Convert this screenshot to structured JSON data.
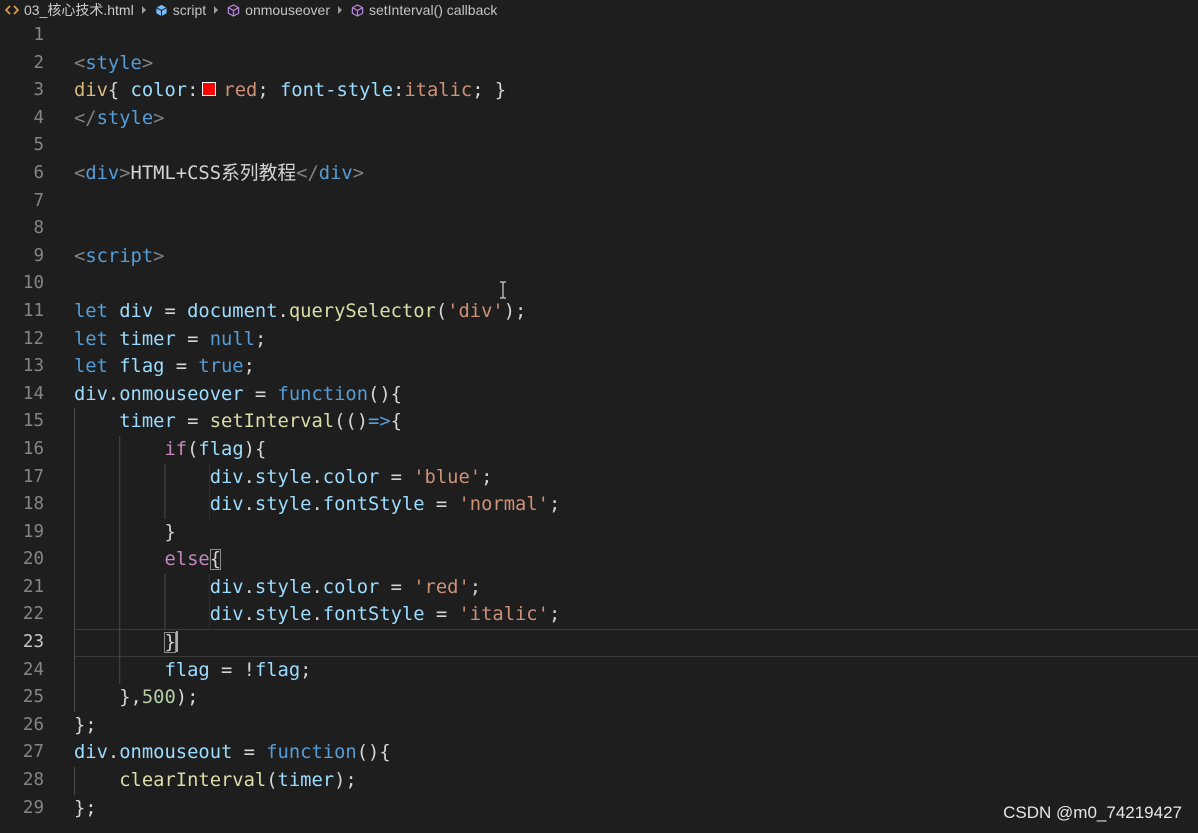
{
  "breadcrumb": {
    "separator_icon": "chevron-right-icon",
    "items": [
      {
        "label": "03_核心技术.html",
        "icon": "file-html-icon",
        "icon_color": "#e8a24f"
      },
      {
        "label": "script",
        "icon": "symbol-module-icon",
        "icon_color": "#75beff"
      },
      {
        "label": "onmouseover",
        "icon": "symbol-method-icon",
        "icon_color": "#b180d7"
      },
      {
        "label": "setInterval() callback",
        "icon": "symbol-method-icon",
        "icon_color": "#b180d7"
      }
    ]
  },
  "theme": {
    "background": "#1e1e1e",
    "line_number": "#858585",
    "line_number_active": "#c6c6c6",
    "indent_guide": "#4a4a4a",
    "tag-bracket": "#808080",
    "tag-name": "#569cd6",
    "css-selector": "#d7ba7d",
    "css-property": "#9cdcfe",
    "css-value": "#ce9178",
    "punctuation": "#d4d4d4",
    "keyword": "#569cd6",
    "variable": "#9cdcfe",
    "function": "#dcdcaa",
    "string": "#ce9178",
    "number": "#b5cea8",
    "control": "#c586c0",
    "text": "#d4d4d4",
    "whitespace": "#d4d4d4"
  },
  "editor": {
    "active_line": 23,
    "lines": [
      {
        "number": "1",
        "tokens": []
      },
      {
        "number": "2",
        "tokens": [
          {
            "type": "tag-bracket",
            "text": "<"
          },
          {
            "type": "tag-name",
            "text": "style"
          },
          {
            "type": "tag-bracket",
            "text": ">"
          }
        ]
      },
      {
        "number": "3",
        "tokens": [
          {
            "type": "css-selector",
            "text": "div"
          },
          {
            "type": "punctuation",
            "text": "{ "
          },
          {
            "type": "css-property",
            "text": "color"
          },
          {
            "type": "punctuation",
            "text": ":"
          },
          {
            "type": "swatch",
            "color": "#ff0000"
          },
          {
            "type": "css-value",
            "text": "red"
          },
          {
            "type": "punctuation",
            "text": "; "
          },
          {
            "type": "css-property",
            "text": "font-style"
          },
          {
            "type": "punctuation",
            "text": ":"
          },
          {
            "type": "css-value",
            "text": "italic"
          },
          {
            "type": "punctuation",
            "text": "; }"
          }
        ]
      },
      {
        "number": "4",
        "tokens": [
          {
            "type": "tag-bracket",
            "text": "</"
          },
          {
            "type": "tag-name",
            "text": "style"
          },
          {
            "type": "tag-bracket",
            "text": ">"
          }
        ]
      },
      {
        "number": "5",
        "tokens": []
      },
      {
        "number": "6",
        "tokens": [
          {
            "type": "tag-bracket",
            "text": "<"
          },
          {
            "type": "tag-name",
            "text": "div"
          },
          {
            "type": "tag-bracket",
            "text": ">"
          },
          {
            "type": "text",
            "text": "HTML+CSS系列教程"
          },
          {
            "type": "tag-bracket",
            "text": "</"
          },
          {
            "type": "tag-name",
            "text": "div"
          },
          {
            "type": "tag-bracket",
            "text": ">"
          }
        ]
      },
      {
        "number": "7",
        "tokens": []
      },
      {
        "number": "8",
        "tokens": []
      },
      {
        "number": "9",
        "tokens": [
          {
            "type": "tag-bracket",
            "text": "<"
          },
          {
            "type": "tag-name",
            "text": "script"
          },
          {
            "type": "tag-bracket",
            "text": ">"
          }
        ]
      },
      {
        "number": "10",
        "tokens": []
      },
      {
        "number": "11",
        "tokens": [
          {
            "type": "keyword",
            "text": "let"
          },
          {
            "type": "punctuation",
            "text": " "
          },
          {
            "type": "variable",
            "text": "div"
          },
          {
            "type": "punctuation",
            "text": " = "
          },
          {
            "type": "variable",
            "text": "document"
          },
          {
            "type": "punctuation",
            "text": "."
          },
          {
            "type": "function",
            "text": "querySelector"
          },
          {
            "type": "punctuation",
            "text": "("
          },
          {
            "type": "string",
            "text": "'div'"
          },
          {
            "type": "punctuation",
            "text": ");"
          }
        ]
      },
      {
        "number": "12",
        "tokens": [
          {
            "type": "keyword",
            "text": "let"
          },
          {
            "type": "punctuation",
            "text": " "
          },
          {
            "type": "variable",
            "text": "timer"
          },
          {
            "type": "punctuation",
            "text": " = "
          },
          {
            "type": "keyword",
            "text": "null"
          },
          {
            "type": "punctuation",
            "text": ";"
          }
        ]
      },
      {
        "number": "13",
        "tokens": [
          {
            "type": "keyword",
            "text": "let"
          },
          {
            "type": "punctuation",
            "text": " "
          },
          {
            "type": "variable",
            "text": "flag"
          },
          {
            "type": "punctuation",
            "text": " = "
          },
          {
            "type": "keyword",
            "text": "true"
          },
          {
            "type": "punctuation",
            "text": ";"
          }
        ]
      },
      {
        "number": "14",
        "tokens": [
          {
            "type": "variable",
            "text": "div"
          },
          {
            "type": "punctuation",
            "text": "."
          },
          {
            "type": "variable",
            "text": "onmouseover"
          },
          {
            "type": "punctuation",
            "text": " = "
          },
          {
            "type": "keyword",
            "text": "function"
          },
          {
            "type": "punctuation",
            "text": "(){"
          }
        ]
      },
      {
        "number": "15",
        "tokens": [
          {
            "type": "whitespace",
            "text": "    "
          },
          {
            "type": "variable",
            "text": "timer"
          },
          {
            "type": "punctuation",
            "text": " = "
          },
          {
            "type": "function",
            "text": "setInterval"
          },
          {
            "type": "punctuation",
            "text": "(()"
          },
          {
            "type": "keyword",
            "text": "=>"
          },
          {
            "type": "punctuation",
            "text": "{"
          }
        ]
      },
      {
        "number": "16",
        "tokens": [
          {
            "type": "whitespace",
            "text": "        "
          },
          {
            "type": "control",
            "text": "if"
          },
          {
            "type": "punctuation",
            "text": "("
          },
          {
            "type": "variable",
            "text": "flag"
          },
          {
            "type": "punctuation",
            "text": "){"
          }
        ]
      },
      {
        "number": "17",
        "tokens": [
          {
            "type": "whitespace",
            "text": "            "
          },
          {
            "type": "variable",
            "text": "div"
          },
          {
            "type": "punctuation",
            "text": "."
          },
          {
            "type": "variable",
            "text": "style"
          },
          {
            "type": "punctuation",
            "text": "."
          },
          {
            "type": "variable",
            "text": "color"
          },
          {
            "type": "punctuation",
            "text": " = "
          },
          {
            "type": "string",
            "text": "'blue'"
          },
          {
            "type": "punctuation",
            "text": ";"
          }
        ]
      },
      {
        "number": "18",
        "tokens": [
          {
            "type": "whitespace",
            "text": "            "
          },
          {
            "type": "variable",
            "text": "div"
          },
          {
            "type": "punctuation",
            "text": "."
          },
          {
            "type": "variable",
            "text": "style"
          },
          {
            "type": "punctuation",
            "text": "."
          },
          {
            "type": "variable",
            "text": "fontStyle"
          },
          {
            "type": "punctuation",
            "text": " = "
          },
          {
            "type": "string",
            "text": "'normal'"
          },
          {
            "type": "punctuation",
            "text": ";"
          }
        ]
      },
      {
        "number": "19",
        "tokens": [
          {
            "type": "whitespace",
            "text": "        "
          },
          {
            "type": "punctuation",
            "text": "}"
          }
        ]
      },
      {
        "number": "20",
        "tokens": [
          {
            "type": "whitespace",
            "text": "        "
          },
          {
            "type": "control",
            "text": "else"
          },
          {
            "type": "punctuation",
            "text": "{",
            "match": true
          }
        ]
      },
      {
        "number": "21",
        "tokens": [
          {
            "type": "whitespace",
            "text": "            "
          },
          {
            "type": "variable",
            "text": "div"
          },
          {
            "type": "punctuation",
            "text": "."
          },
          {
            "type": "variable",
            "text": "style"
          },
          {
            "type": "punctuation",
            "text": "."
          },
          {
            "type": "variable",
            "text": "color"
          },
          {
            "type": "punctuation",
            "text": " = "
          },
          {
            "type": "string",
            "text": "'red'"
          },
          {
            "type": "punctuation",
            "text": ";"
          }
        ]
      },
      {
        "number": "22",
        "tokens": [
          {
            "type": "whitespace",
            "text": "            "
          },
          {
            "type": "variable",
            "text": "div"
          },
          {
            "type": "punctuation",
            "text": "."
          },
          {
            "type": "variable",
            "text": "style"
          },
          {
            "type": "punctuation",
            "text": "."
          },
          {
            "type": "variable",
            "text": "fontStyle"
          },
          {
            "type": "punctuation",
            "text": " = "
          },
          {
            "type": "string",
            "text": "'italic'"
          },
          {
            "type": "punctuation",
            "text": ";"
          }
        ]
      },
      {
        "number": "23",
        "tokens": [
          {
            "type": "whitespace",
            "text": "        "
          },
          {
            "type": "punctuation",
            "text": "}",
            "match": true
          }
        ]
      },
      {
        "number": "24",
        "tokens": [
          {
            "type": "whitespace",
            "text": "        "
          },
          {
            "type": "variable",
            "text": "flag"
          },
          {
            "type": "punctuation",
            "text": " = !"
          },
          {
            "type": "variable",
            "text": "flag"
          },
          {
            "type": "punctuation",
            "text": ";"
          }
        ]
      },
      {
        "number": "25",
        "tokens": [
          {
            "type": "whitespace",
            "text": "    "
          },
          {
            "type": "punctuation",
            "text": "},"
          },
          {
            "type": "number",
            "text": "500"
          },
          {
            "type": "punctuation",
            "text": ");"
          }
        ]
      },
      {
        "number": "26",
        "tokens": [
          {
            "type": "punctuation",
            "text": "};"
          }
        ]
      },
      {
        "number": "27",
        "tokens": [
          {
            "type": "variable",
            "text": "div"
          },
          {
            "type": "punctuation",
            "text": "."
          },
          {
            "type": "variable",
            "text": "onmouseout"
          },
          {
            "type": "punctuation",
            "text": " = "
          },
          {
            "type": "keyword",
            "text": "function"
          },
          {
            "type": "punctuation",
            "text": "(){"
          }
        ]
      },
      {
        "number": "28",
        "tokens": [
          {
            "type": "whitespace",
            "text": "    "
          },
          {
            "type": "function",
            "text": "clearInterval"
          },
          {
            "type": "punctuation",
            "text": "("
          },
          {
            "type": "variable",
            "text": "timer"
          },
          {
            "type": "punctuation",
            "text": ");"
          }
        ]
      },
      {
        "number": "29",
        "tokens": [
          {
            "type": "punctuation",
            "text": "};"
          }
        ]
      }
    ]
  },
  "mouse_pointer_icon": "text-cursor-icon",
  "watermark": "CSDN @m0_74219427"
}
